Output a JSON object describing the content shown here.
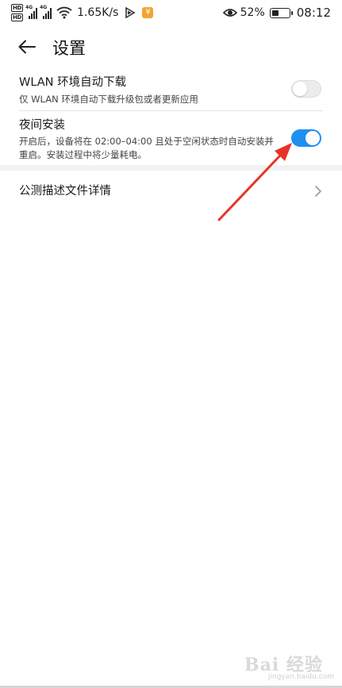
{
  "status_bar": {
    "hd_badges": [
      "HD",
      "HD"
    ],
    "network_types": [
      "4G",
      "4G"
    ],
    "net_speed": "1.65K/s",
    "app_badge_glyph": "¥",
    "battery_percent": "52%",
    "battery_level": 0.52,
    "time": "08:12",
    "icons": [
      "hd-icon",
      "signal-icon",
      "wifi-icon",
      "play-icon",
      "app-badge-icon",
      "eye-icon",
      "battery-icon"
    ]
  },
  "header": {
    "back_icon": "arrow-left-icon",
    "title": "设置"
  },
  "settings": {
    "wlan_download": {
      "title": "WLAN 环境自动下载",
      "subtitle": "仅 WLAN 环境自动下载升级包或者更新应用",
      "enabled": false
    },
    "night_install": {
      "title": "夜间安装",
      "subtitle_line1": "开启后，设备将在 02:00–04:00 且处于空闲状态时自动安装并",
      "subtitle_line2": "重启。安装过程中将少量耗电。",
      "enabled": true
    },
    "beta_details": {
      "title": "公测描述文件详情",
      "icon": "chevron-right-icon"
    }
  },
  "colors": {
    "toggle_on": "#1f8ff0",
    "toggle_off": "#ececec",
    "annotation_arrow": "#e8332a"
  },
  "watermark": {
    "logo": "Bai 经验",
    "subtext": "jingyan.baidu.com"
  }
}
